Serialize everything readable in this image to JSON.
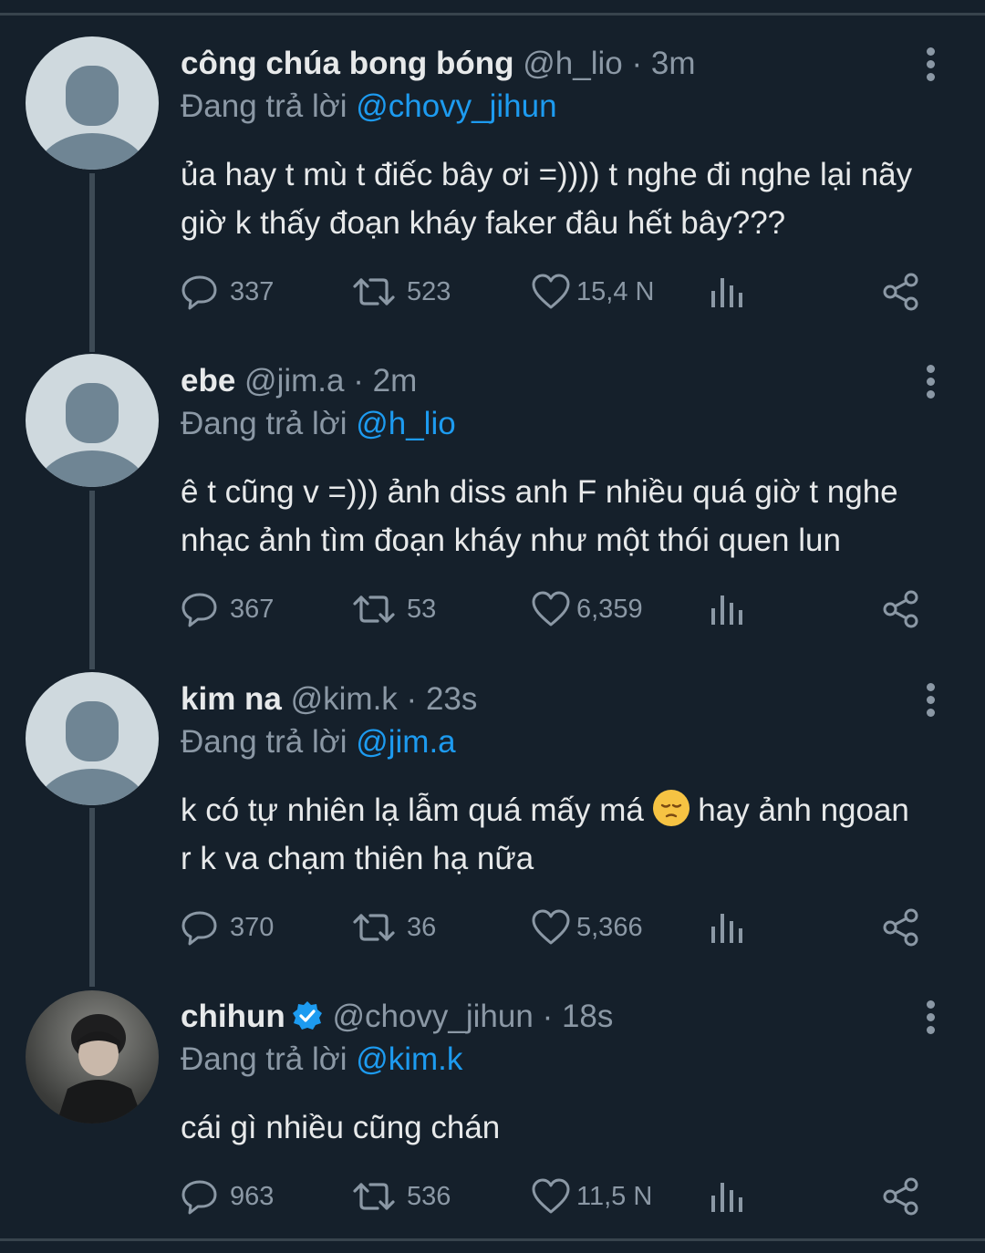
{
  "tweets": [
    {
      "display_name": "công chúa bong bóng",
      "handle": "@h_lio",
      "time": "3m",
      "reply_prefix": "Đang trả lời",
      "reply_to": "@chovy_jihun",
      "text_lines": [
        "ủa hay t mù t điếc bây ơi =)))) t nghe đi nghe lại nãy",
        "giờ k thấy đoạn kháy faker đâu hết bây???"
      ],
      "replies": "337",
      "retweets": "523",
      "likes": "15,4 N"
    },
    {
      "display_name": "ebe",
      "handle": "@jim.a",
      "time": "2m",
      "reply_prefix": "Đang trả lời",
      "reply_to": "@h_lio",
      "text_lines": [
        "ê t cũng v =))) ảnh diss anh F nhiều quá giờ t nghe",
        "nhạc ảnh tìm đoạn kháy như một thói quen lun"
      ],
      "replies": "367",
      "retweets": "53",
      "likes": "6,359"
    },
    {
      "display_name": "kim na",
      "handle": "@kim.k",
      "time": "23s",
      "reply_prefix": "Đang trả lời",
      "reply_to": "@jim.a",
      "text_line1_a": "k có tự nhiên lạ lẫm quá mấy má",
      "text_line1_b": "hay ảnh ngoan",
      "text_line2": "r k va chạm thiên hạ nữa",
      "replies": "370",
      "retweets": "36",
      "likes": "5,366"
    },
    {
      "display_name": "chihun",
      "handle": "@chovy_jihun",
      "time": "18s",
      "reply_prefix": "Đang trả lời",
      "reply_to": "@kim.k",
      "text_lines": [
        "cái gì nhiều cũng chán"
      ],
      "replies": "963",
      "retweets": "536",
      "likes": "11,5 N"
    }
  ],
  "separator": "·",
  "colors": {
    "background": "#15202b",
    "text": "#e7e9ea",
    "secondary": "#8b98a5",
    "link": "#1d9bf0",
    "thread_line": "#3d4a55"
  },
  "icons": {
    "reply": "reply-icon",
    "retweet": "retweet-icon",
    "like": "heart-icon",
    "views": "analytics-icon",
    "share": "share-icon",
    "more": "more-options-icon",
    "verified": "verified-badge-icon"
  }
}
